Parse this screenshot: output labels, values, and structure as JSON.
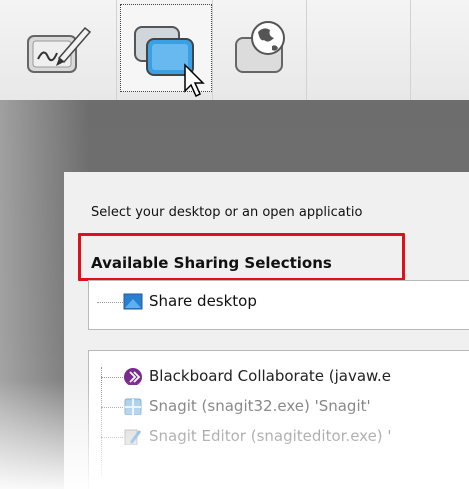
{
  "toolbar": {
    "buttons": [
      {
        "name": "whiteboard",
        "icon": "whiteboard-pen-icon"
      },
      {
        "name": "application-sharing",
        "icon": "application-sharing-icon"
      },
      {
        "name": "web-tour",
        "icon": "globe-icon"
      }
    ]
  },
  "dialog": {
    "prompt": "Select your desktop or an open applicatio",
    "section_heading": "Available Sharing Selections",
    "share_desktop_label": "Share desktop",
    "applications": [
      {
        "label": "Blackboard Collaborate (javaw.e",
        "icon": "collaborate-icon"
      },
      {
        "label": "Snagit (snagit32.exe) 'Snagit'",
        "icon": "snagit-icon"
      },
      {
        "label": "Snagit Editor (snagiteditor.exe) '",
        "icon": "snagit-editor-icon"
      }
    ]
  },
  "colors": {
    "highlight": "#e0101a",
    "collaborate": "#7b2a8e",
    "desktop_icon": "#2a7fd1"
  }
}
